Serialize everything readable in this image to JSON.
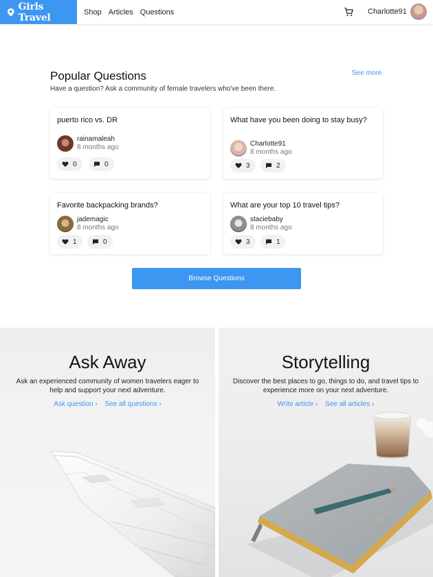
{
  "header": {
    "brand": "Girls Travel",
    "nav": [
      "Shop",
      "Articles",
      "Questions"
    ],
    "username": "Charlotte91"
  },
  "popular": {
    "title": "Popular Questions",
    "subtitle": "Have a question? Ask a community of female travelers who've been there.",
    "see_more": "See more",
    "questions": [
      {
        "question": "puerto rico vs. DR",
        "user": "rainamaleah",
        "time": "8 months ago",
        "likes": "0",
        "comments": "0"
      },
      {
        "question": "What have you been doing to stay busy?",
        "user": "Charlotte91",
        "time": "8 months ago",
        "likes": "3",
        "comments": "2"
      },
      {
        "question": "Favorite backpacking brands?",
        "user": "jademagic",
        "time": "8 months ago",
        "likes": "1",
        "comments": "0"
      },
      {
        "question": "What are your top 10 travel tips?",
        "user": "staciebaby",
        "time": "8 months ago",
        "likes": "3",
        "comments": "1"
      }
    ],
    "browse_button": "Browse Questions"
  },
  "panels": {
    "ask": {
      "title": "Ask Away",
      "text": "Ask an experienced community of women travelers eager to help and support your next adventure.",
      "link1": "Ask question ›",
      "link2": "See all questions ›"
    },
    "story": {
      "title": "Storytelling",
      "text": "Discover the best places to go, things to do, and travel tips to experience more on your next adventure.",
      "link1": "Write article ›",
      "link2": "See all articles ›"
    }
  },
  "colors": {
    "accent": "#3d96f0"
  },
  "icons": [
    "pin-icon",
    "cart-icon",
    "heart-icon",
    "comment-icon"
  ]
}
